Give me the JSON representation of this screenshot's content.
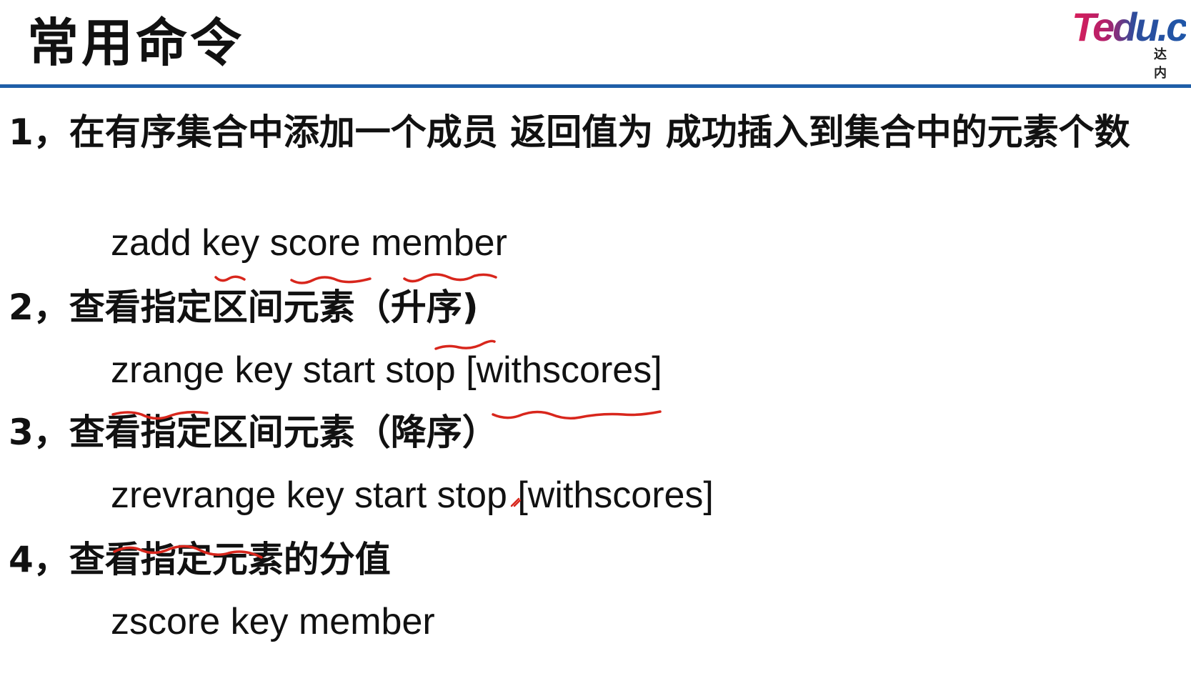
{
  "slide": {
    "title": "常用命令",
    "logo": {
      "word": "Tedu.c",
      "cn": "达内"
    }
  },
  "items": [
    {
      "heading": "1，在有序集合中添加一个成员 返回值为 成功插入到集合中的元素个数",
      "command": "zadd key score member"
    },
    {
      "heading": "2，查看指定区间元素（升序)",
      "command": "zrange key start stop [withscores]"
    },
    {
      "heading": "3，查看指定区间元素（降序）",
      "command": "zrevrange key start stop [withscores]"
    },
    {
      "heading": "4，查看指定元素的分值",
      "command": "zscore key member"
    }
  ],
  "colors": {
    "rule": "#1f5fa8",
    "annotation": "#d8261c"
  }
}
